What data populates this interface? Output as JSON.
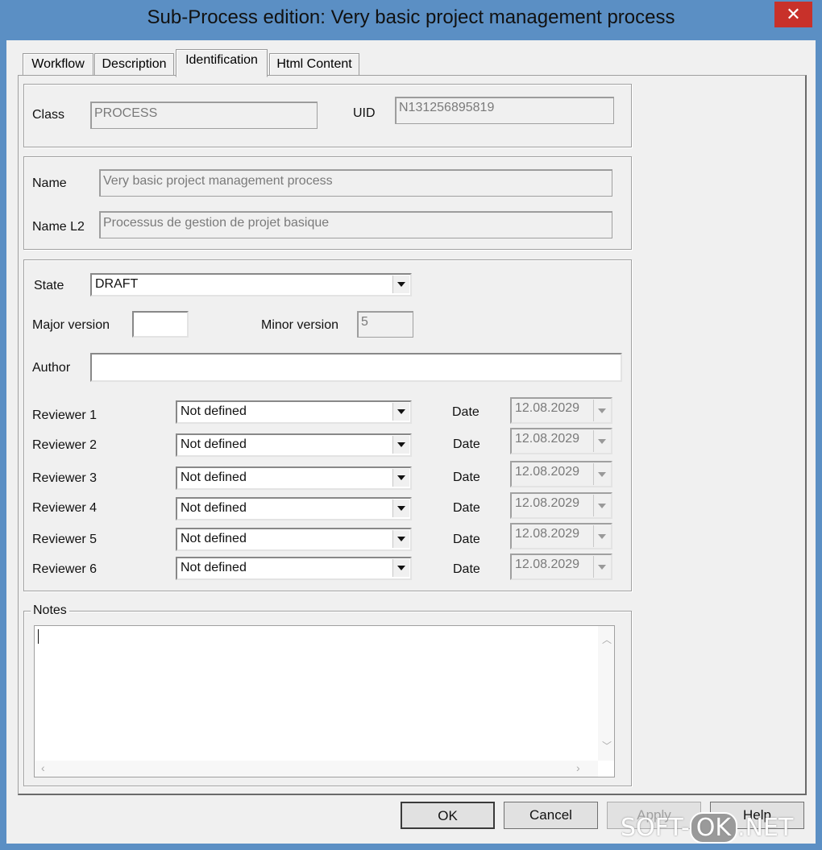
{
  "window": {
    "title": "Sub-Process edition: Very basic project management process",
    "close_glyph": "✕"
  },
  "tabs": [
    {
      "label": "Workflow"
    },
    {
      "label": "Description"
    },
    {
      "label": "Identification"
    },
    {
      "label": "Html Content"
    }
  ],
  "identification": {
    "class_label": "Class",
    "class_value": "PROCESS",
    "uid_label": "UID",
    "uid_value": "N131256895819",
    "name_label": "Name",
    "name_value": "Very basic project management process",
    "name_l2_label": "Name L2",
    "name_l2_value": "Processus de gestion de projet basique",
    "state_label": "State",
    "state_value": "DRAFT",
    "major_version_label": "Major version",
    "major_version_value": "",
    "minor_version_label": "Minor version",
    "minor_version_value": "5",
    "author_label": "Author",
    "author_value": ""
  },
  "reviewers": [
    {
      "label": "Reviewer 1",
      "value": "Not defined",
      "date_label": "Date",
      "date": "12.08.2029"
    },
    {
      "label": "Reviewer 2",
      "value": "Not defined",
      "date_label": "Date",
      "date": "12.08.2029"
    },
    {
      "label": "Reviewer 3",
      "value": "Not defined",
      "date_label": "Date",
      "date": "12.08.2029"
    },
    {
      "label": "Reviewer 4",
      "value": "Not defined",
      "date_label": "Date",
      "date": "12.08.2029"
    },
    {
      "label": "Reviewer 5",
      "value": "Not defined",
      "date_label": "Date",
      "date": "12.08.2029"
    },
    {
      "label": "Reviewer 6",
      "value": "Not defined",
      "date_label": "Date",
      "date": "12.08.2029"
    }
  ],
  "notes": {
    "label": "Notes",
    "value": ""
  },
  "buttons": {
    "ok": "OK",
    "cancel": "Cancel",
    "apply": "Apply",
    "help": "Help"
  },
  "watermark": {
    "left": "SOFT-",
    "pill": "OK",
    "right": ".NET"
  },
  "colors": {
    "titlebar": "#5b8fc4",
    "close": "#c8312a",
    "dialog_bg": "#f0f0f0"
  }
}
